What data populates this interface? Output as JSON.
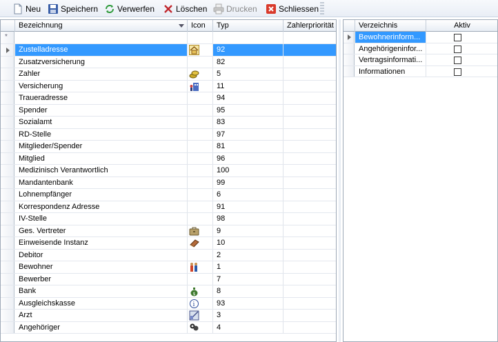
{
  "toolbar": {
    "buttons": [
      {
        "label": "Neu",
        "icon": "new-document-icon",
        "enabled": true
      },
      {
        "label": "Speichern",
        "icon": "save-disk-icon",
        "enabled": true
      },
      {
        "label": "Verwerfen",
        "icon": "refresh-discard-icon",
        "enabled": true
      },
      {
        "label": "Löschen",
        "icon": "delete-x-icon",
        "enabled": true
      },
      {
        "label": "Drucken",
        "icon": "printer-icon",
        "enabled": false
      },
      {
        "label": "Schliessen",
        "icon": "close-red-icon",
        "enabled": true
      }
    ]
  },
  "left_grid": {
    "columns": [
      "Bezeichnung",
      "Icon",
      "Typ",
      "Zahlerpriorität"
    ],
    "new_row_marker": "*",
    "selected_index": 0,
    "rows": [
      {
        "bezeichnung": "Zustelladresse",
        "icon": "house-icon",
        "typ": "92",
        "prio": ""
      },
      {
        "bezeichnung": "Zusatzversicherung",
        "icon": "",
        "typ": "82",
        "prio": ""
      },
      {
        "bezeichnung": "Zahler",
        "icon": "coins-icon",
        "typ": "5",
        "prio": ""
      },
      {
        "bezeichnung": "Versicherung",
        "icon": "insurance-icon",
        "typ": "11",
        "prio": ""
      },
      {
        "bezeichnung": "Traueradresse",
        "icon": "",
        "typ": "94",
        "prio": ""
      },
      {
        "bezeichnung": "Spender",
        "icon": "",
        "typ": "95",
        "prio": ""
      },
      {
        "bezeichnung": "Sozialamt",
        "icon": "",
        "typ": "83",
        "prio": ""
      },
      {
        "bezeichnung": "RD-Stelle",
        "icon": "",
        "typ": "97",
        "prio": ""
      },
      {
        "bezeichnung": "Mitglieder/Spender",
        "icon": "",
        "typ": "81",
        "prio": ""
      },
      {
        "bezeichnung": "Mitglied",
        "icon": "",
        "typ": "96",
        "prio": ""
      },
      {
        "bezeichnung": "Medizinisch Verantwortlich",
        "icon": "",
        "typ": "100",
        "prio": ""
      },
      {
        "bezeichnung": "Mandantenbank",
        "icon": "",
        "typ": "99",
        "prio": ""
      },
      {
        "bezeichnung": "Lohnempfänger",
        "icon": "",
        "typ": "6",
        "prio": ""
      },
      {
        "bezeichnung": "Korrespondenz Adresse",
        "icon": "",
        "typ": "91",
        "prio": ""
      },
      {
        "bezeichnung": "IV-Stelle",
        "icon": "",
        "typ": "98",
        "prio": ""
      },
      {
        "bezeichnung": "Ges. Vertreter",
        "icon": "briefcase-icon",
        "typ": "9",
        "prio": ""
      },
      {
        "bezeichnung": "Einweisende Instanz",
        "icon": "book-icon",
        "typ": "10",
        "prio": ""
      },
      {
        "bezeichnung": "Debitor",
        "icon": "",
        "typ": "2",
        "prio": ""
      },
      {
        "bezeichnung": "Bewohner",
        "icon": "residents-icon",
        "typ": "1",
        "prio": ""
      },
      {
        "bezeichnung": "Bewerber",
        "icon": "",
        "typ": "7",
        "prio": ""
      },
      {
        "bezeichnung": "Bank",
        "icon": "money-bag-icon",
        "typ": "8",
        "prio": ""
      },
      {
        "bezeichnung": "Ausgleichskasse",
        "icon": "info-person-icon",
        "typ": "93",
        "prio": ""
      },
      {
        "bezeichnung": "Arzt",
        "icon": "doctor-icon",
        "typ": "3",
        "prio": ""
      },
      {
        "bezeichnung": "Angehöriger",
        "icon": "relatives-icon",
        "typ": "4",
        "prio": ""
      }
    ]
  },
  "right_grid": {
    "columns": [
      "Verzeichnis",
      "Aktiv"
    ],
    "selected_index": 0,
    "rows": [
      {
        "verzeichnis": "Bewohnerinform...",
        "aktiv": false
      },
      {
        "verzeichnis": "Angehörigeninfor...",
        "aktiv": false
      },
      {
        "verzeichnis": "Vertragsinformati...",
        "aktiv": false
      },
      {
        "verzeichnis": "Informationen",
        "aktiv": false
      }
    ]
  },
  "colors": {
    "selection": "#3399ff",
    "grid_border": "#9da8b6"
  }
}
